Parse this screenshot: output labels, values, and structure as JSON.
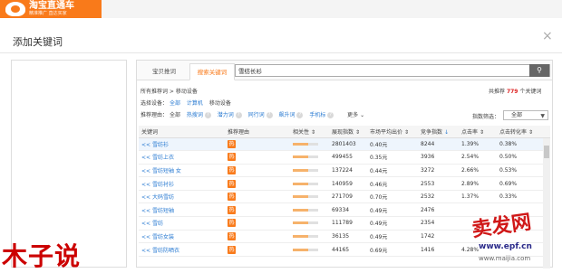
{
  "logo": {
    "title": "淘宝直通车",
    "subtitle": "精准推广 直达买家"
  },
  "dialog": {
    "title": "添加关键词",
    "close": "×"
  },
  "tabs": [
    {
      "label": "宝贝推词"
    },
    {
      "label": "搜索关键词"
    }
  ],
  "search": {
    "value": "雪纺长衫",
    "button_icon": "search-icon"
  },
  "filter": {
    "breadcrumb": "所有推荐词 > 移动设备",
    "device_label": "选择设备：",
    "device_options": [
      "全部",
      "计算机",
      "移动设备"
    ],
    "reason_label": "推荐理由：",
    "reason_options": [
      "全部",
      "热搜词",
      "潜力词",
      "同行词",
      "飙升词",
      "手机标"
    ],
    "more": "更多",
    "total_prefix": "共推荐",
    "total_count": "779",
    "total_suffix": "个关键词",
    "index_filter_label": "指数筛选：",
    "index_filter_value": "全部"
  },
  "table": {
    "columns": [
      "关键词",
      "推荐理由",
      "相关性",
      "展现指数",
      "市场平均出价",
      "竞争指数",
      "点击率",
      "点击转化率"
    ],
    "rows": [
      {
        "keyword": "<< 雪纺衫",
        "index": "2801403",
        "bid": "0.40元",
        "competition": "8244",
        "ctr": "1.39%",
        "cvr": "0.38%"
      },
      {
        "keyword": "<< 雪纺上衣",
        "index": "499455",
        "bid": "0.35元",
        "competition": "3936",
        "ctr": "2.54%",
        "cvr": "0.50%"
      },
      {
        "keyword": "<< 雪纺短袖 女",
        "index": "137224",
        "bid": "0.44元",
        "competition": "3272",
        "ctr": "2.66%",
        "cvr": "0.53%"
      },
      {
        "keyword": "<< 雪纺衬衫",
        "index": "140959",
        "bid": "0.46元",
        "competition": "2553",
        "ctr": "2.89%",
        "cvr": "0.69%"
      },
      {
        "keyword": "<< 大码雪纺",
        "index": "271709",
        "bid": "0.70元",
        "competition": "2532",
        "ctr": "1.37%",
        "cvr": "0.33%"
      },
      {
        "keyword": "<< 雪纺短袖",
        "index": "69334",
        "bid": "0.49元",
        "competition": "2476",
        "ctr": "",
        "cvr": ""
      },
      {
        "keyword": "<< 雪纺",
        "index": "111789",
        "bid": "0.49元",
        "competition": "2354",
        "ctr": "",
        "cvr": ""
      },
      {
        "keyword": "<< 雪纺女装",
        "index": "36135",
        "bid": "0.49元",
        "competition": "1742",
        "ctr": "",
        "cvr": ""
      },
      {
        "keyword": "<< 雪纺防晒衣",
        "index": "44165",
        "bid": "0.69元",
        "competition": "1416",
        "ctr": "4.28%",
        "cvr": ""
      }
    ],
    "reason_badge": "热"
  },
  "watermarks": {
    "left": "木子说",
    "right": "卖发网",
    "url": "www.epf.cn",
    "url2": "www.maijia.com"
  }
}
